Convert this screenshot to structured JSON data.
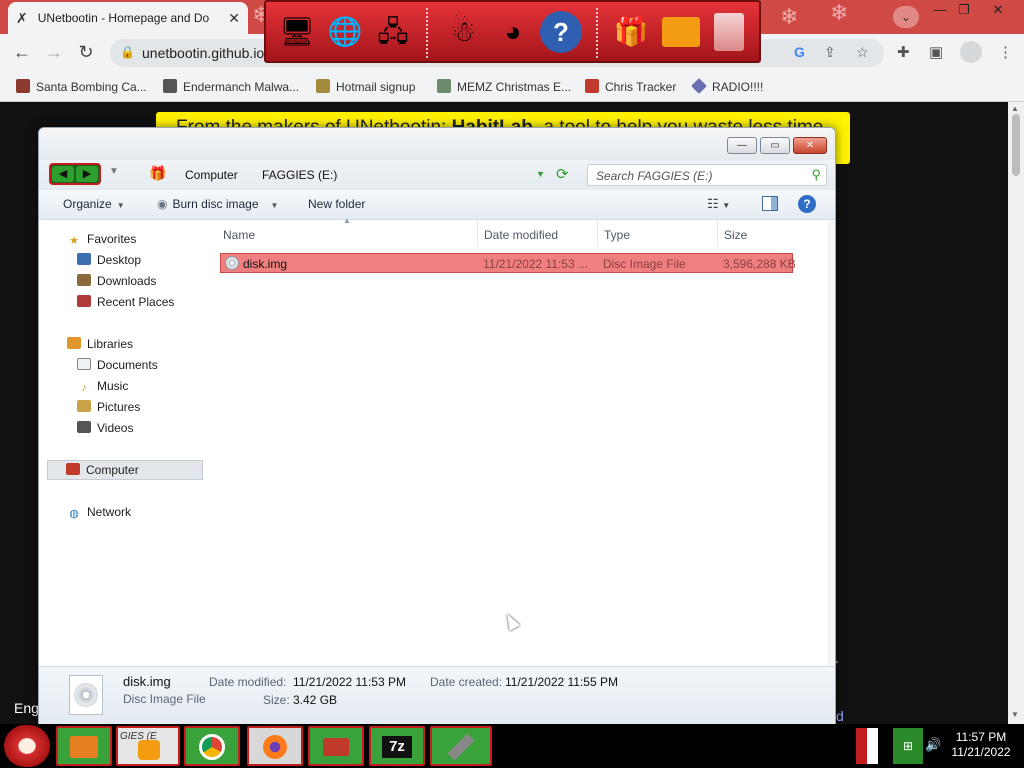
{
  "browser": {
    "tab_title": "UNetbootin - Homepage and Do",
    "url": "unetbootin.github.io",
    "bookmarks": [
      "Santa Bombing Ca...",
      "Endermanch Malwa...",
      "Hotmail signup",
      "MEMZ Christmas E...",
      "Chris Tracker",
      "RADIO!!!!"
    ],
    "icons": {
      "tab_favicon": "unetbootin-favicon",
      "lock": "lock-icon",
      "google": "google-icon",
      "share": "share-icon",
      "star": "star-icon",
      "extensions": "puzzle-icon",
      "sidepanel": "sidepanel-icon",
      "profile": "profile-icon",
      "menu": "kebab-menu-icon"
    }
  },
  "webpage": {
    "banner_prefix": "From the makers of UNetbootin: ",
    "banner_bold": "HabitLab",
    "banner_suffix": ", a tool to help you waste less time",
    "lang_text": "Eng",
    "banner_color": "#fff200"
  },
  "dock": {
    "icons": [
      "christmas-computer-icon",
      "globe-icon",
      "network-icon",
      "snowman-icon",
      "windows-update-icon",
      "help-icon",
      "gift-icon",
      "folder-icon",
      "recycle-bin-icon"
    ]
  },
  "explorer": {
    "breadcrumb": [
      "Computer",
      "FAGGIES (E:)"
    ],
    "search_placeholder": "Search FAGGIES (E:)",
    "commands": {
      "organize": "Organize",
      "burn": "Burn disc image",
      "new_folder": "New folder"
    },
    "nav": {
      "favorites": "Favorites",
      "favorites_items": [
        "Desktop",
        "Downloads",
        "Recent Places"
      ],
      "libraries": "Libraries",
      "libraries_items": [
        "Documents",
        "Music",
        "Pictures",
        "Videos"
      ],
      "computer": "Computer",
      "network": "Network"
    },
    "columns": {
      "name": "Name",
      "date": "Date modified",
      "type": "Type",
      "size": "Size"
    },
    "files": [
      {
        "name": "disk.img",
        "date": "11/21/2022 11:53 ...",
        "type": "Disc Image File",
        "size": "3,596,288 KB"
      }
    ],
    "details": {
      "name": "disk.img",
      "type": "Disc Image File",
      "modified_label": "Date modified:",
      "modified": "11/21/2022 11:53 PM",
      "created_label": "Date created:",
      "created": "11/21/2022 11:55 PM",
      "size_label": "Size:",
      "size": "3.42 GB"
    },
    "colors": {
      "selection": "#f08080",
      "accent": "#2e9e2e"
    }
  },
  "taskbar": {
    "time": "11:57 PM",
    "date": "11/21/2022",
    "apps": [
      "folder-icon",
      "media-player-icon",
      "chrome-icon",
      "firefox-icon",
      "toolbox-icon",
      "7zip-icon",
      "usb-drive-icon"
    ],
    "seven_zip_label": "7z",
    "media_label": "GIES (E"
  }
}
